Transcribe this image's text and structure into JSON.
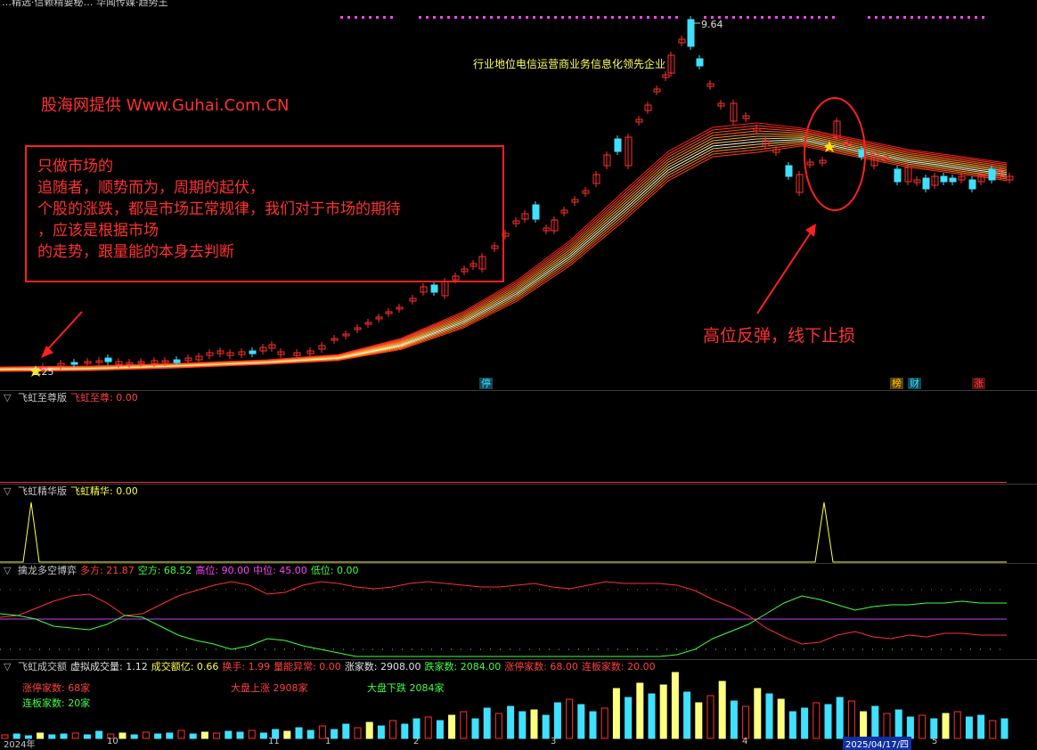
{
  "top": {
    "title_fragment": "…精选·信赖精要秘… 华闻传媒·趋势王",
    "price_high": "9.64",
    "price_low": "2.25",
    "industry_note": "行业地位电信运营商业务信息化领先企业",
    "watermark": "股海网提供 Www.Guhai.Com.CN",
    "note_lines": [
      "只做市场的",
      "追随者，顺势而为，周期的起伏，",
      "个股的涨跌，都是市场正常规律，我们对于市场的期待",
      "，应该是根据市场",
      "的走势，跟量能的本身去判断"
    ],
    "arrow_note": "高位反弹，线下止损",
    "tags": [
      {
        "text": "停",
        "color": "#40e0ff"
      },
      {
        "text": "榜",
        "color": "#ffcc00"
      },
      {
        "text": "财",
        "color": "#40e0ff"
      },
      {
        "text": "涨",
        "color": "#ff4040"
      }
    ]
  },
  "panel1": {
    "name": "飞虹至尊版",
    "indicator": "飞虹至尊: 0.00"
  },
  "panel2": {
    "name": "飞虹精华版",
    "indicator": "飞虹精华: 0.00"
  },
  "panel3": {
    "name": "擒龙多空博弈",
    "items": [
      {
        "label": "多方: 21.87",
        "color": "#ff4040"
      },
      {
        "label": "空方: 68.52",
        "color": "#40ff40"
      },
      {
        "label": "高位: 90.00",
        "color": "#ff40ff"
      },
      {
        "label": "中位: 45.00",
        "color": "#ff40ff"
      },
      {
        "label": "低位: 0.00",
        "color": "#40ff40"
      }
    ]
  },
  "panel4": {
    "name": "飞虹成交额",
    "items": [
      {
        "label": "虚拟成交量: 1.12",
        "color": "#e0e0e0"
      },
      {
        "label": "成交额亿: 0.66",
        "color": "#ffff40"
      },
      {
        "label": "换手: 1.99",
        "color": "#ff4040"
      },
      {
        "label": "量能异常: 0.00",
        "color": "#ff4040"
      },
      {
        "label": "涨家数: 2908.00",
        "color": "#e0e0e0"
      },
      {
        "label": "跌家数: 2084.00",
        "color": "#40ff40"
      },
      {
        "label": "涨停家数: 68.00",
        "color": "#ff4040"
      },
      {
        "label": "连板家数: 20.00",
        "color": "#ff4040"
      }
    ],
    "stat_limit_up": "涨停家数: 68家",
    "stat_cont": "连板家数: 20家",
    "stat_up": "大盘上涨 2908家",
    "stat_down": "大盘下跌 2084家"
  },
  "axis": {
    "year_label": "2024年",
    "months": [
      "10",
      "11",
      "1",
      "2",
      "3",
      "4",
      "5"
    ],
    "cursor_date": "2025/04/17/四"
  },
  "colors": {
    "up": "#ff3030",
    "down": "#40e0ff",
    "ribbon": "#ff6030"
  }
}
